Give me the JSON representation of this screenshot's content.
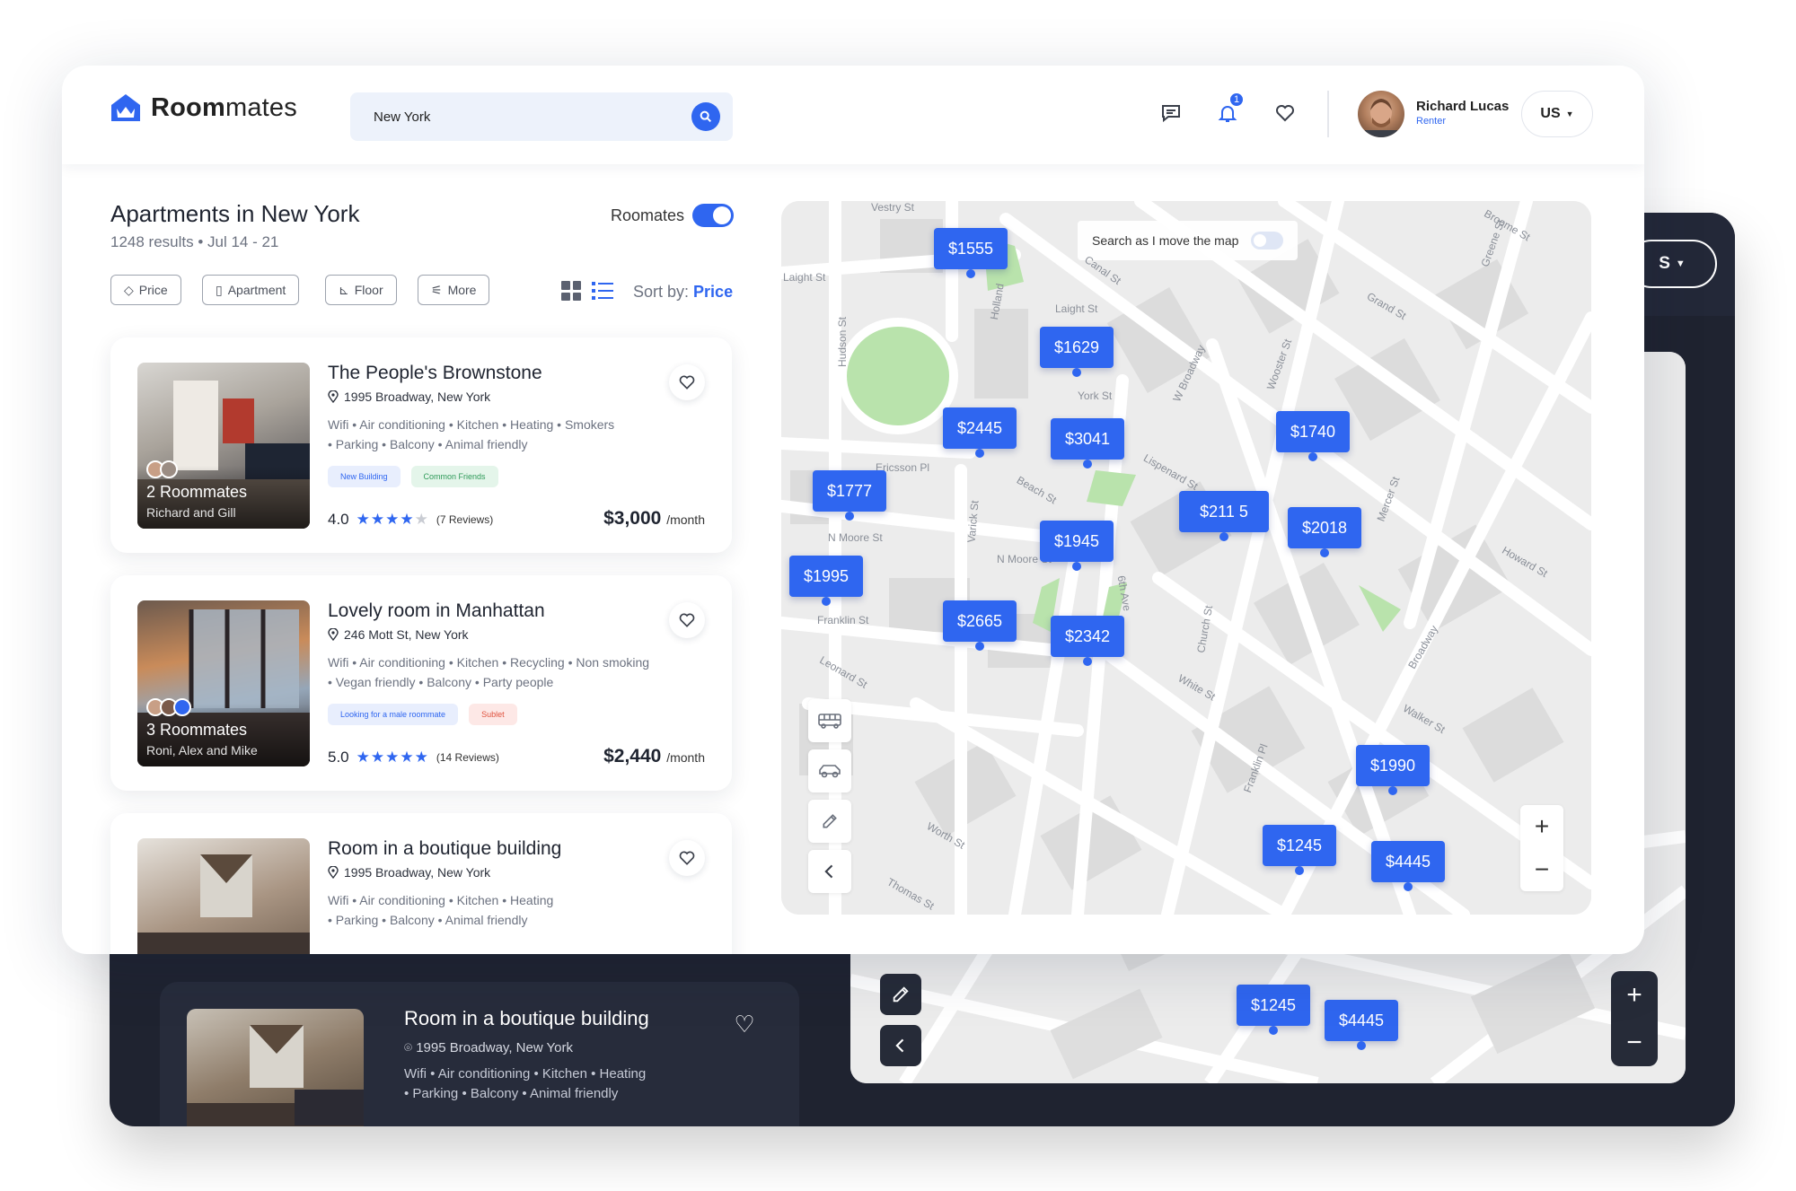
{
  "brand": {
    "name_bold": "Room",
    "name_light": "mates"
  },
  "search": {
    "value": "New York"
  },
  "header": {
    "notification_count": "1",
    "user_name": "Richard Lucas",
    "user_role": "Renter",
    "lang": "US"
  },
  "listing": {
    "title": "Apartments in New York",
    "subtitle": "1248 results • Jul 14 - 21",
    "roomates_label": "Roomates",
    "roomates_toggle_on": true,
    "filters": [
      "Price",
      "Apartment",
      "Floor",
      "More"
    ],
    "sort_label": "Sort by:",
    "sort_value": "Price"
  },
  "cards": [
    {
      "title": "The People's Brownstone",
      "address": "1995 Broadway, New York",
      "amenities_1": "Wifi • Air conditioning • Kitchen • Heating • Smokers",
      "amenities_2": "• Parking • Balcony • Animal friendly",
      "tags": [
        "New Building",
        "Common Friends"
      ],
      "rating": "4.0",
      "stars": 4,
      "reviews": "(7 Reviews)",
      "price": "$3,000",
      "per": "/month",
      "roommates_count": "2 Roommates",
      "roommates_names": "Richard and Gill"
    },
    {
      "title": "Lovely room in Manhattan",
      "address": "246 Mott St, New York",
      "amenities_1": "Wifi • Air conditioning • Kitchen • Recycling  • Non smoking",
      "amenities_2": "• Vegan friendly • Balcony  • Party people",
      "tags": [
        "Looking for a male roommate",
        "Sublet"
      ],
      "rating": "5.0",
      "stars": 5,
      "reviews": "(14 Reviews)",
      "price": "$2,440",
      "per": "/month",
      "roommates_count": "3 Roommates",
      "roommates_names": "Roni, Alex and Mike"
    },
    {
      "title": "Room in a boutique building",
      "address": "1995 Broadway, New York",
      "amenities_1": "Wifi • Air conditioning • Kitchen • Heating",
      "amenities_2": "• Parking • Balcony • Animal friendly"
    }
  ],
  "map": {
    "search_chip": "Search as I move the map",
    "pins": [
      "$1555",
      "$1629",
      "$2445",
      "$3041",
      "$1740",
      "$1777",
      "$211 5",
      "$2018",
      "$1945",
      "$1995",
      "$2665",
      "$2342",
      "$1990",
      "$1245",
      "$4445"
    ],
    "streets": [
      "Vestry St",
      "Laight St",
      "Hudson St",
      "Holland",
      "Canal St",
      "Laight St",
      "York St",
      "Ericsson Pl",
      "Beach St",
      "Varick St",
      "N Moore St",
      "N Moore St",
      "Franklin St",
      "Leonard St",
      "Worth St",
      "Thomas St",
      "Church St",
      "White St",
      "Franklin Pl",
      "Walker St",
      "Broadway",
      "Mercer St",
      "Howard St",
      "Grand St",
      "Wooster St",
      "Greene St",
      "Broome St",
      "W Broadway",
      "Lispenard St",
      "6th Ave",
      "Ericsson Pl"
    ]
  },
  "dark": {
    "card_title": "Room in a boutique building",
    "card_address": "1995 Broadway, New York",
    "card_amen_1": "Wifi • Air conditioning • Kitchen • Heating",
    "card_amen_2": "• Parking • Balcony • Animal friendly",
    "pins": [
      "$1245",
      "$4445"
    ],
    "lang_partial": "S"
  }
}
